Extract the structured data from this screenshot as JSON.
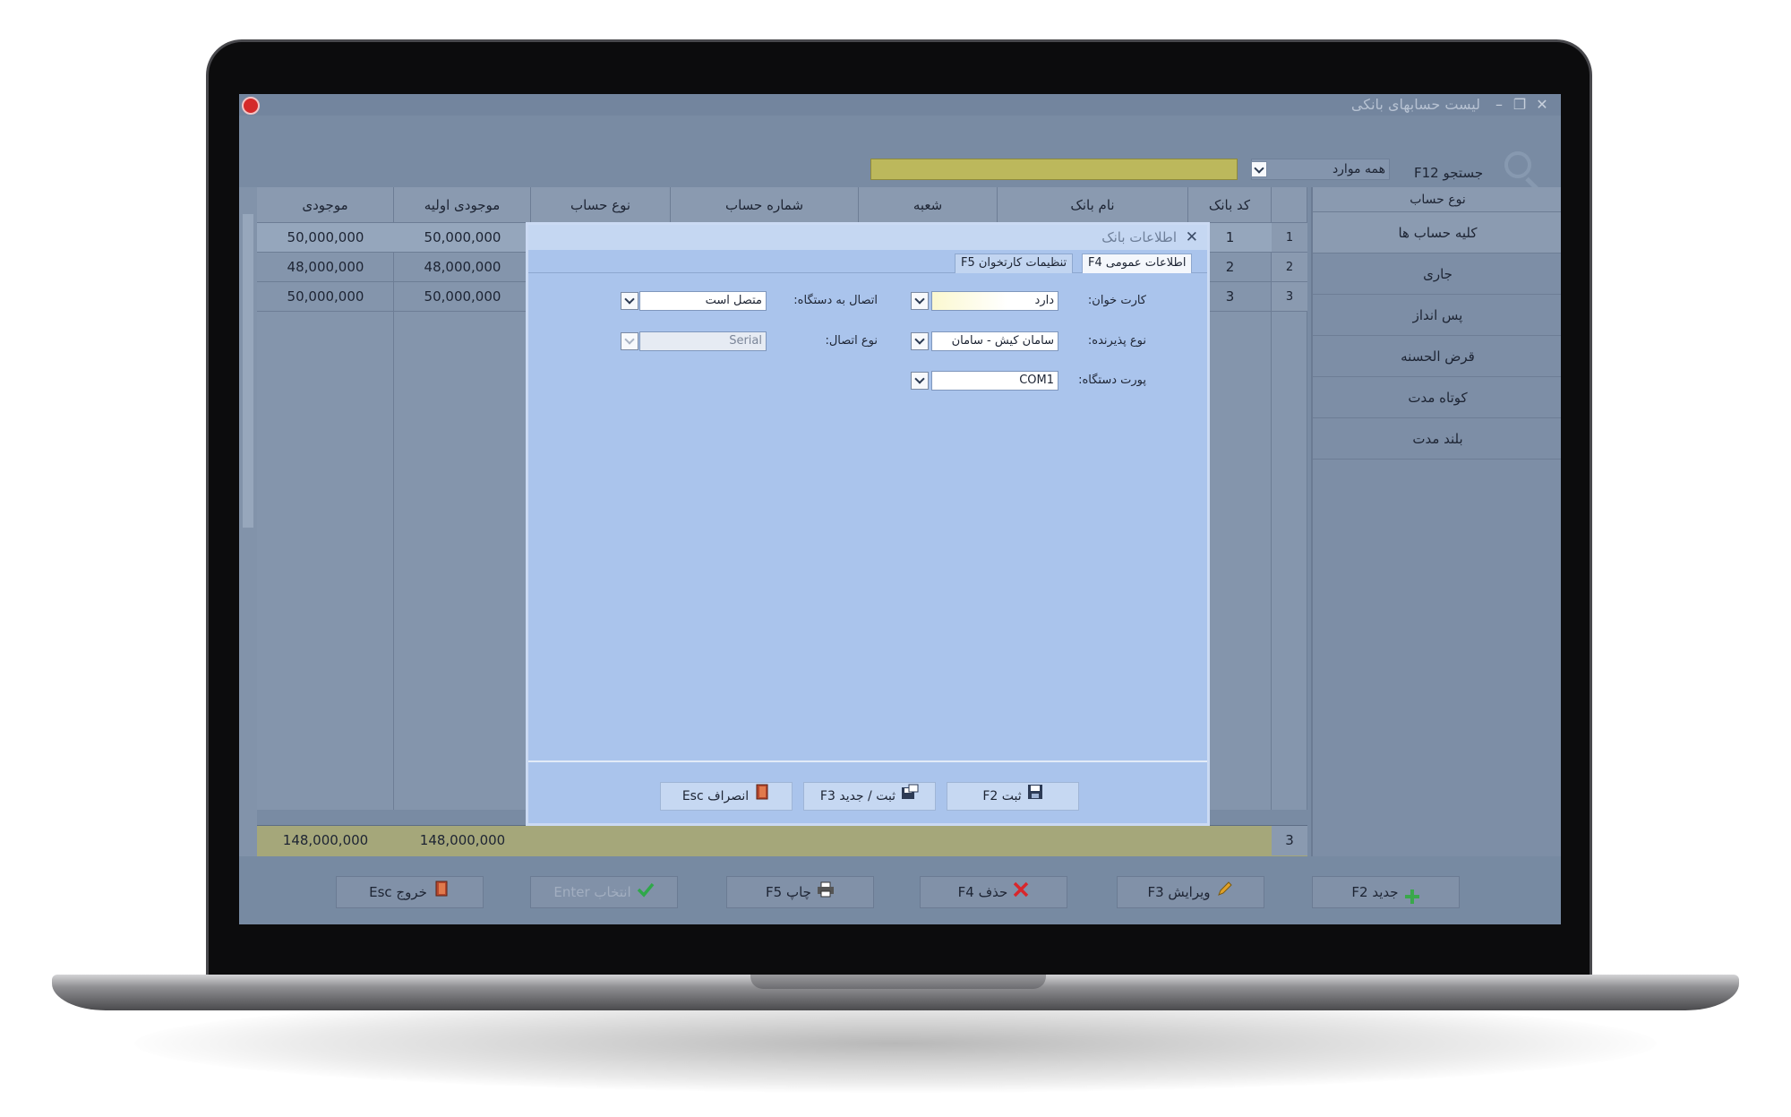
{
  "window": {
    "title": "لیست حسابهای بانکی",
    "minimize": "–",
    "restore": "❐",
    "close": "✕"
  },
  "search": {
    "label": "جستجو F12",
    "scope": "همه موارد",
    "value": ""
  },
  "grid": {
    "headers": [
      "کد بانک",
      "نام بانک",
      "شعبه",
      "شماره حساب",
      "نوع حساب",
      "موجودی اولیه",
      "موجودی"
    ],
    "rows": [
      {
        "index": "1",
        "code": "1",
        "initial": "50,000,000",
        "balance": "50,000,000"
      },
      {
        "index": "2",
        "code": "2",
        "initial": "48,000,000",
        "balance": "48,000,000"
      },
      {
        "index": "3",
        "code": "3",
        "initial": "50,000,000",
        "balance": "50,000,000"
      }
    ],
    "footer": {
      "count": "3",
      "initial_total": "148,000,000",
      "balance_total": "148,000,000"
    }
  },
  "sidebar": {
    "header": "نوع حساب",
    "items": [
      "کلیه حساب ها",
      "جاری",
      "پس انداز",
      "قرض الحسنه",
      "کوتاه مدت",
      "بلند مدت"
    ]
  },
  "bottom_buttons": {
    "new": "جدید F2",
    "edit": "ویرایش F3",
    "delete": "حذف F4",
    "print": "چاپ F5",
    "select": "انتخاب Enter",
    "exit": "خروج Esc"
  },
  "dialog": {
    "title": "اطلاعات بانک",
    "tabs": [
      "اطلاعات عمومی F4",
      "تنظیمات کارتخوان F5"
    ],
    "fields": {
      "card_reader_label": "کارت خوان:",
      "card_reader_value": "دارد",
      "acceptor_type_label": "نوع پذیرنده:",
      "acceptor_type_value": "سامان کیش - سامان",
      "device_port_label": "پورت دستگاه:",
      "device_port_value": "COM1",
      "device_connection_label": "اتصال به دستگاه:",
      "device_connection_value": "متصل است",
      "connection_type_label": "نوع اتصال:",
      "connection_type_value": "Serial"
    },
    "buttons": {
      "save": "ثبت F2",
      "save_new": "ثبت / جدید F3",
      "cancel": "انصراف Esc"
    }
  },
  "colors": {
    "accent_red": "#d42a2a",
    "check_green": "#2fa84a",
    "delete_red": "#d9262b",
    "new_green": "#3aa84b"
  }
}
